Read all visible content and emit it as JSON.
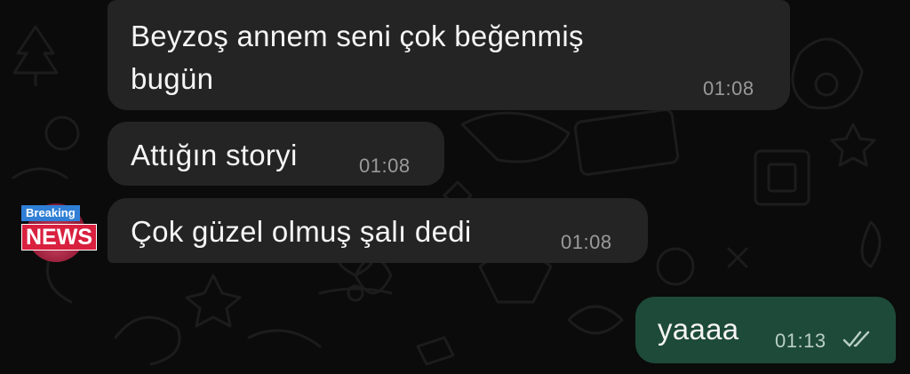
{
  "conversation": {
    "messages": [
      {
        "direction": "incoming",
        "lines": [
          "Beyzoş annem seni çok beğenmiş",
          "bugün"
        ],
        "time": "01:08"
      },
      {
        "direction": "incoming",
        "lines": [
          "Attığın storyi"
        ],
        "time": "01:08"
      },
      {
        "direction": "incoming",
        "lines": [
          "Çok güzel olmuş şalı dedi"
        ],
        "time": "01:08"
      },
      {
        "direction": "outgoing",
        "lines": [
          "yaaaa"
        ],
        "time": "01:13",
        "status_icon": "double-check-read-icon"
      }
    ]
  },
  "sender_avatar": {
    "badge_top": "Breaking",
    "badge_bottom": "NEWS"
  },
  "colors": {
    "background": "#0b0b0b",
    "incoming_bubble": "#242424",
    "outgoing_bubble": "#1e4a3a",
    "text": "#f5f5f5",
    "timestamp": "#9a9a9a"
  }
}
